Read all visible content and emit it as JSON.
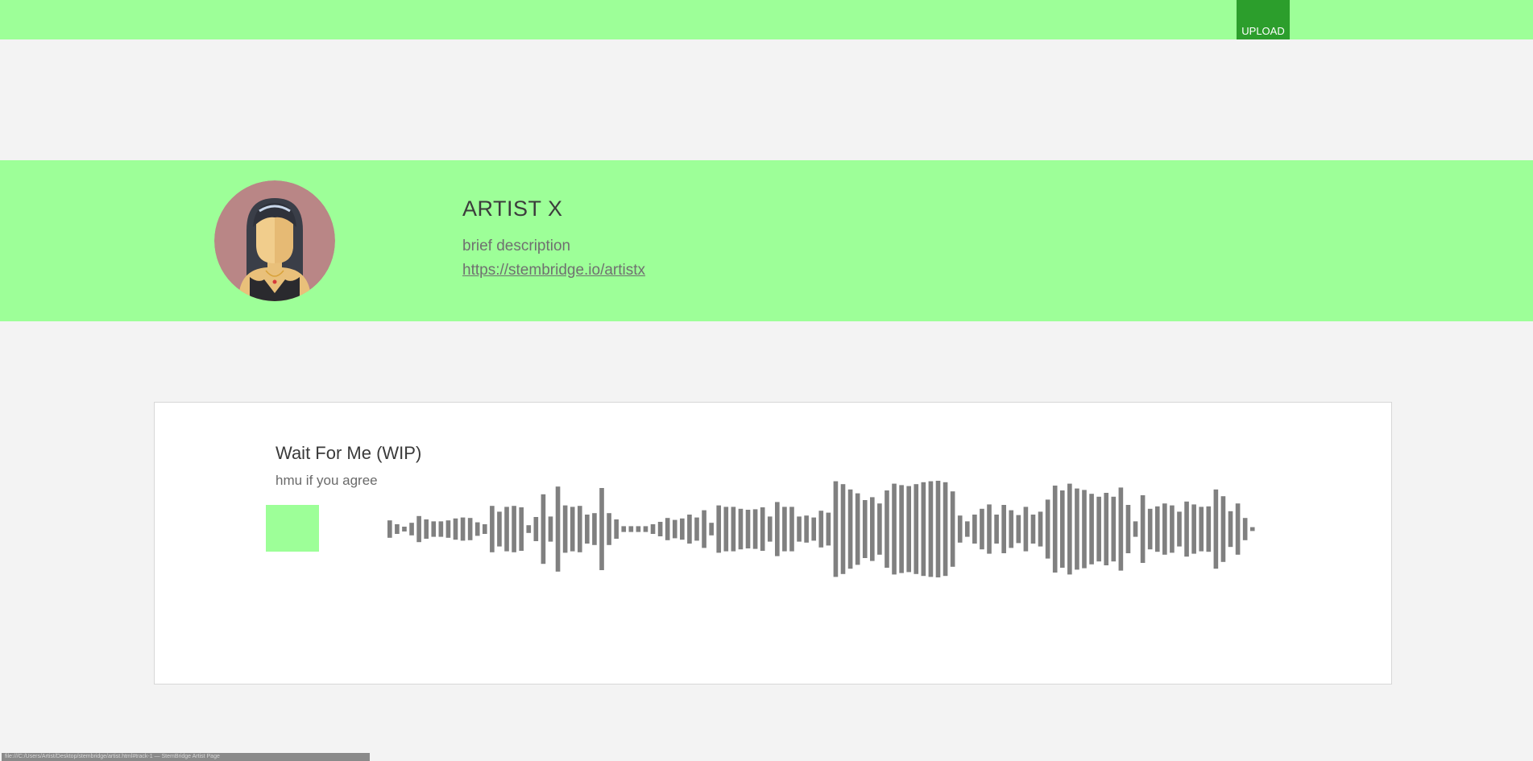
{
  "header": {
    "upload_label": "UPLOAD",
    "background_color": "#9dff98",
    "upload_color": "#2c9e2c"
  },
  "profile": {
    "name": "ARTIST X",
    "description": "brief description",
    "link": "https://stembridge.io/artistx",
    "avatar_icon": "female-artist-avatar-icon"
  },
  "track": {
    "title": "Wait For Me (WIP)",
    "description": "hmu if you agree",
    "waveform_color": "#808080",
    "play_button_color": "#9dff98",
    "waveform_levels": [
      0.18,
      0.1,
      0.05,
      0.13,
      0.27,
      0.2,
      0.16,
      0.16,
      0.18,
      0.22,
      0.24,
      0.23,
      0.14,
      0.1,
      0.48,
      0.36,
      0.46,
      0.48,
      0.45,
      0.08,
      0.25,
      0.72,
      0.26,
      0.88,
      0.49,
      0.46,
      0.48,
      0.3,
      0.33,
      0.85,
      0.33,
      0.2,
      0.06,
      0.06,
      0.06,
      0.06,
      0.1,
      0.15,
      0.23,
      0.19,
      0.22,
      0.3,
      0.24,
      0.39,
      0.13,
      0.49,
      0.46,
      0.46,
      0.42,
      0.4,
      0.41,
      0.45,
      0.26,
      0.56,
      0.46,
      0.46,
      0.26,
      0.28,
      0.24,
      0.38,
      0.34,
      0.99,
      0.93,
      0.82,
      0.74,
      0.6,
      0.66,
      0.53,
      0.8,
      0.94,
      0.91,
      0.89,
      0.93,
      0.97,
      0.99,
      1.0,
      0.97,
      0.78,
      0.28,
      0.16,
      0.3,
      0.42,
      0.51,
      0.3,
      0.5,
      0.39,
      0.29,
      0.46,
      0.3,
      0.36,
      0.61,
      0.9,
      0.8,
      0.94,
      0.84,
      0.81,
      0.73,
      0.67,
      0.75,
      0.67,
      0.86,
      0.5,
      0.16,
      0.7,
      0.42,
      0.47,
      0.53,
      0.49,
      0.36,
      0.57,
      0.51,
      0.46,
      0.47,
      0.82,
      0.68,
      0.37,
      0.53,
      0.23,
      0.04
    ]
  },
  "status_bar": {
    "text": "file:///C:/Users/Artist/Desktop/stembridge/artist.html#track-1 — StemBridge Artist Page"
  }
}
